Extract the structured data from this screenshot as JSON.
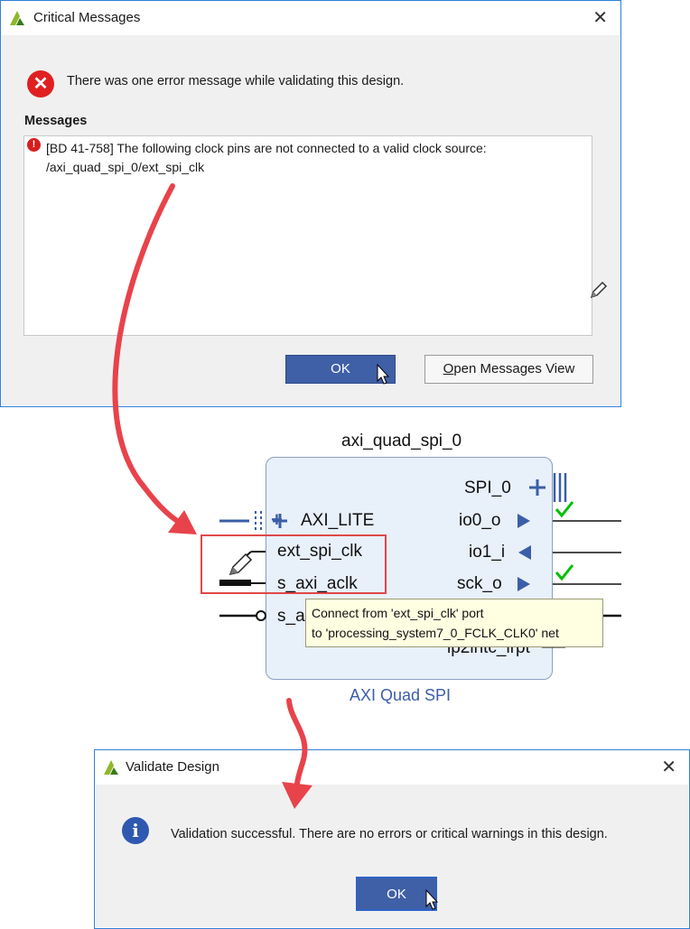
{
  "critical_dialog": {
    "title": "Critical Messages",
    "summary": "There was one error message while validating this design.",
    "messages_label": "Messages",
    "messages": [
      {
        "line1": "[BD 41-758] The following clock pins are not connected to a valid clock source:",
        "line2": "/axi_quad_spi_0/ext_spi_clk"
      }
    ],
    "ok_label": "OK",
    "open_view_label": "Open Messages View",
    "open_view_mnemonic": "O",
    "open_view_rest": "pen Messages View"
  },
  "diagram": {
    "instance_name": "axi_quad_spi_0",
    "ip_name": "AXI Quad SPI",
    "left_ports": [
      "AXI_LITE",
      "ext_spi_clk",
      "s_axi_aclk",
      "s_a"
    ],
    "right_ports": [
      "SPI_0",
      "io0_o",
      "io1_i",
      "sck_o",
      "ip2intc_irpt"
    ],
    "tooltip": {
      "line1": "Connect from 'ext_spi_clk' port",
      "line2": "to 'processing_system7_0_FCLK_CLK0' net"
    }
  },
  "validate_dialog": {
    "title": "Validate Design",
    "message": "Validation successful. There are no errors or critical warnings in this design.",
    "ok_label": "OK"
  },
  "colors": {
    "accent": "#2f7fd8",
    "button_primary": "#3f5fa6",
    "error_red": "#e02020",
    "info_blue": "#2f58b0",
    "check_green": "#00c000",
    "annotation_red": "#e8434b"
  }
}
